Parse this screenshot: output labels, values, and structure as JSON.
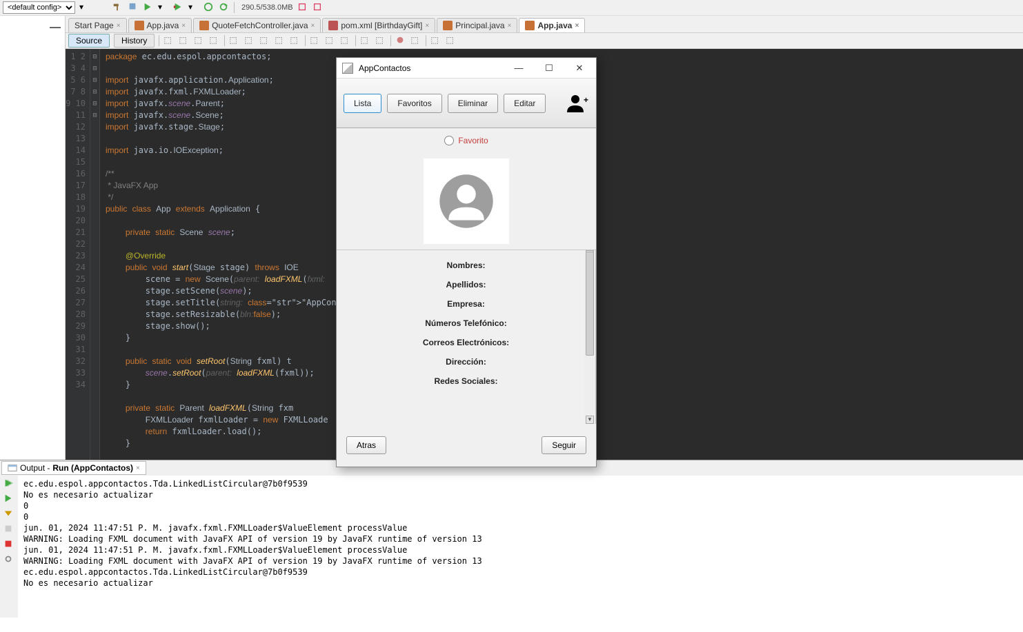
{
  "toolbar": {
    "config_label": "<default config>",
    "memory": "290.5/538.0MB"
  },
  "tabs": [
    {
      "label": "Start Page",
      "active": false
    },
    {
      "label": "App.java",
      "active": false
    },
    {
      "label": "QuoteFetchController.java",
      "active": false
    },
    {
      "label": "pom.xml [BirthdayGift]",
      "active": false
    },
    {
      "label": "Principal.java",
      "active": false
    },
    {
      "label": "App.java",
      "active": true
    }
  ],
  "srcbar": {
    "source": "Source",
    "history": "History"
  },
  "code_lines": [
    "package ec.edu.espol.appcontactos;",
    "",
    "import javafx.application.Application;",
    "import javafx.fxml.FXMLLoader;",
    "import javafx.scene.Parent;",
    "import javafx.scene.Scene;",
    "import javafx.stage.Stage;",
    "",
    "import java.io.IOException;",
    "",
    "/**",
    " * JavaFX App",
    " */",
    "public class App extends Application {",
    "",
    "    private static Scene scene;",
    "",
    "    @Override",
    "    public void start(Stage stage) throws IOE",
    "        scene = new Scene(parent: loadFXML(fxml:",
    "        stage.setScene(scene);",
    "        stage.setTitle(string: \"AppContactos\");",
    "        stage.setResizable(bln:false);",
    "        stage.show();",
    "    }",
    "",
    "    public static void setRoot(String fxml) t",
    "        scene.setRoot(parent: loadFXML(fxml));",
    "    }",
    "",
    "    private static Parent loadFXML(String fxm",
    "        FXMLLoader fxmlLoader = new FXMLLoade",
    "        return fxmlLoader.load();",
    "    }"
  ],
  "line_start": 1,
  "line_end": 34,
  "output": {
    "tab_prefix": "Output - ",
    "tab_bold": "Run (AppContactos)",
    "lines": [
      "ec.edu.espol.appcontactos.Tda.LinkedListCircular@7b0f9539",
      "No es necesario actualizar",
      "0",
      "0",
      "jun. 01, 2024 11:47:51 P. M. javafx.fxml.FXMLLoader$ValueElement processValue",
      "WARNING: Loading FXML document with JavaFX API of version 19 by JavaFX runtime of version 13",
      "jun. 01, 2024 11:47:51 P. M. javafx.fxml.FXMLLoader$ValueElement processValue",
      "WARNING: Loading FXML document with JavaFX API of version 19 by JavaFX runtime of version 13",
      "ec.edu.espol.appcontactos.Tda.LinkedListCircular@7b0f9539",
      "No es necesario actualizar"
    ]
  },
  "fx": {
    "title": "AppContactos",
    "btn_lista": "Lista",
    "btn_favoritos": "Favoritos",
    "btn_eliminar": "Eliminar",
    "btn_editar": "Editar",
    "favorito": "Favorito",
    "fields": [
      "Nombres:",
      "Apellidos:",
      "Empresa:",
      "Números Telefónico:",
      "Correos Electrónicos:",
      "Dirección:",
      "Redes Sociales:"
    ],
    "btn_atras": "Atras",
    "btn_seguir": "Seguir"
  }
}
